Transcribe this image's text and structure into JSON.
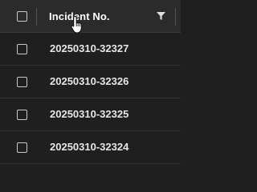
{
  "header": {
    "column_title": "Incident No.",
    "filter_icon": "filter-funnel-icon"
  },
  "rows": [
    {
      "incident_no": "20250310-32327"
    },
    {
      "incident_no": "20250310-32326"
    },
    {
      "incident_no": "20250310-32325"
    },
    {
      "incident_no": "20250310-32324"
    }
  ],
  "colors": {
    "background": "#1f1f1f",
    "header_background": "#2b2b2b",
    "text": "#e6e6e6",
    "header_text": "#ffffff",
    "checkbox_border": "#c8c8c8"
  }
}
